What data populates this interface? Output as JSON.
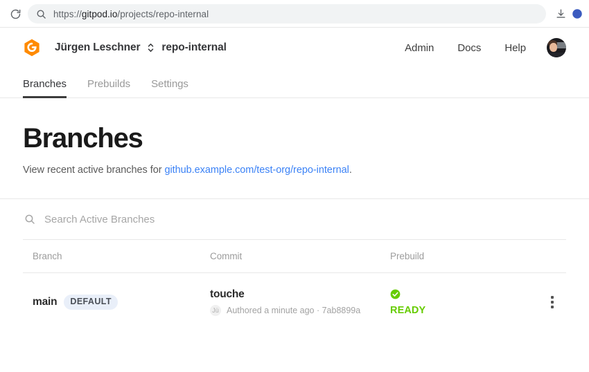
{
  "browser": {
    "reload_icon": "reload-icon",
    "search_icon": "search-icon",
    "url_scheme": "https://",
    "url_host": "gitpod.io",
    "url_path": "/projects/repo-internal",
    "download_icon": "download-icon",
    "extension_icon": "extension-icon"
  },
  "header": {
    "logo_icon": "gitpod-logo-icon",
    "logo_color": "#FF8A00",
    "org_name": "Jürgen Leschner",
    "switcher_icon": "chevron-up-down-icon",
    "project_name": "repo-internal",
    "nav": [
      {
        "label": "Admin"
      },
      {
        "label": "Docs"
      },
      {
        "label": "Help"
      }
    ],
    "avatar_icon": "user-avatar"
  },
  "tabs": [
    {
      "label": "Branches",
      "active": true
    },
    {
      "label": "Prebuilds",
      "active": false
    },
    {
      "label": "Settings",
      "active": false
    }
  ],
  "main": {
    "title": "Branches",
    "subtitle_prefix": "View recent active branches for ",
    "subtitle_link": "github.example.com/test-org/repo-internal",
    "subtitle_suffix": ".",
    "link_color": "#3b82f6"
  },
  "search": {
    "icon": "search-icon",
    "placeholder": "Search Active Branches",
    "value": ""
  },
  "table": {
    "columns": [
      {
        "key": "branch",
        "label": "Branch"
      },
      {
        "key": "commit",
        "label": "Commit"
      },
      {
        "key": "prebuild",
        "label": "Prebuild"
      }
    ],
    "rows": [
      {
        "branch": "main",
        "badge": "DEFAULT",
        "commit_message": "touche",
        "author_initials": "Jü",
        "commit_meta": "Authored a minute ago · 7ab8899a",
        "prebuild_status": "READY",
        "prebuild_status_icon": "check-circle-icon",
        "prebuild_status_color": "#66cc00",
        "menu_icon": "kebab-menu-icon"
      }
    ]
  }
}
